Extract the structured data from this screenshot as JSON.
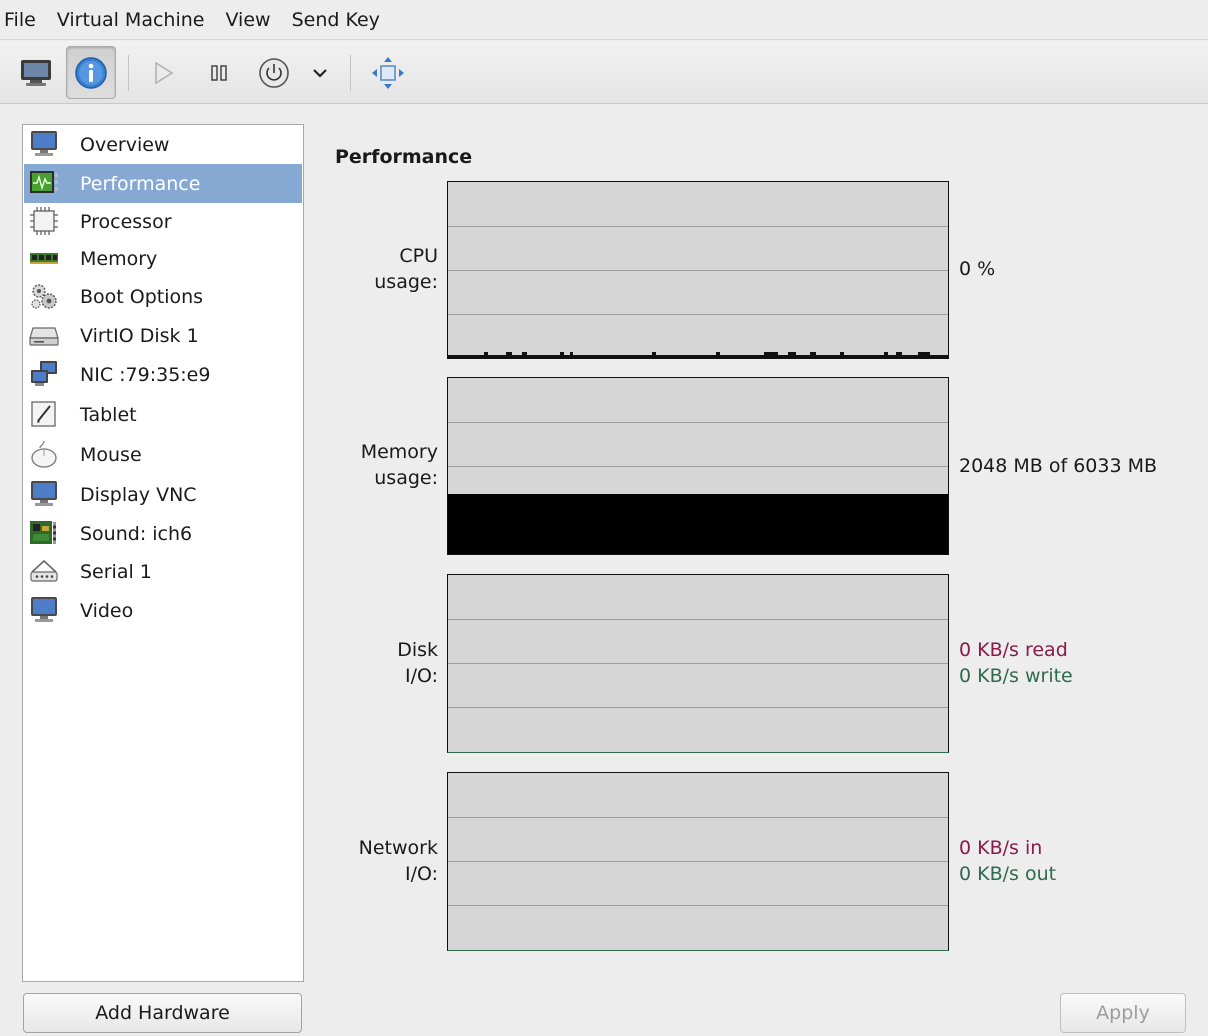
{
  "menubar": {
    "items": [
      {
        "label": "File",
        "name": "menu-file"
      },
      {
        "label": "Virtual Machine",
        "name": "menu-virtual-machine"
      },
      {
        "label": "View",
        "name": "menu-view"
      },
      {
        "label": "Send Key",
        "name": "menu-send-key"
      }
    ]
  },
  "toolbar": {
    "buttons": [
      "console-view-icon",
      "details-view-icon",
      "run-icon",
      "pause-icon",
      "power-icon",
      "power-menu-chevron-icon",
      "fullscreen-icon"
    ],
    "active": "details-view-icon"
  },
  "sidebar": {
    "items": [
      {
        "label": "Overview",
        "icon": "monitor-icon"
      },
      {
        "label": "Performance",
        "icon": "performance-chart-icon",
        "selected": true
      },
      {
        "label": "Processor",
        "icon": "cpu-chip-icon"
      },
      {
        "label": "Memory",
        "icon": "memory-module-icon"
      },
      {
        "label": "Boot Options",
        "icon": "gears-icon"
      },
      {
        "label": "VirtIO Disk 1",
        "icon": "hard-disk-icon"
      },
      {
        "label": "NIC :79:35:e9",
        "icon": "network-icon"
      },
      {
        "label": "Tablet",
        "icon": "tablet-icon"
      },
      {
        "label": "Mouse",
        "icon": "mouse-icon"
      },
      {
        "label": "Display VNC",
        "icon": "display-icon"
      },
      {
        "label": "Sound: ich6",
        "icon": "sound-card-icon"
      },
      {
        "label": "Serial 1",
        "icon": "serial-port-icon"
      },
      {
        "label": "Video",
        "icon": "video-icon"
      }
    ],
    "add_hardware_label": "Add Hardware"
  },
  "details": {
    "title": "Performance",
    "graphs": {
      "cpu": {
        "label_line1": "CPU",
        "label_line2": "usage:",
        "value": "0 %"
      },
      "memory": {
        "label_line1": "Memory",
        "label_line2": "usage:",
        "value": "2048 MB of 6033 MB",
        "used_fraction": 0.34
      },
      "disk": {
        "label_line1": "Disk",
        "label_line2": "I/O:",
        "read": "0 KB/s read",
        "write": "0 KB/s write"
      },
      "network": {
        "label_line1": "Network",
        "label_line2": "I/O:",
        "in": "0 KB/s in",
        "out": "0 KB/s out"
      }
    },
    "apply_label": "Apply"
  },
  "colors": {
    "selection": "#86a9d4",
    "graph_background": "#d6d6d6",
    "read_in": "#8a1a4a",
    "write_out": "#2f6a4f"
  }
}
